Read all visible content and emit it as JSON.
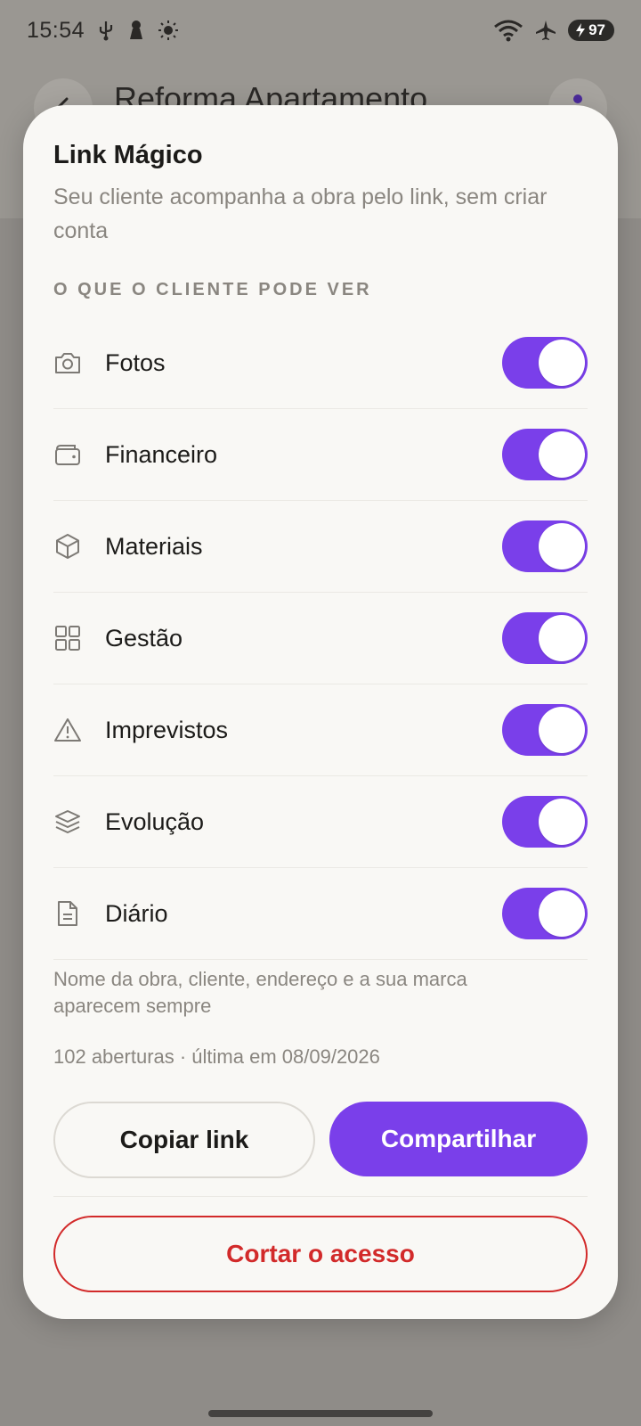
{
  "status_bar": {
    "time": "15:54",
    "battery": "97"
  },
  "background_app": {
    "title": "Reforma Apartamento"
  },
  "sheet": {
    "title": "Link Mágico",
    "subtitle": "Seu cliente acompanha a obra pelo link, sem criar conta",
    "section_label": "O QUE O CLIENTE PODE VER",
    "toggles": [
      {
        "label": "Fotos",
        "icon": "camera-icon",
        "on": true
      },
      {
        "label": "Financeiro",
        "icon": "wallet-icon",
        "on": true
      },
      {
        "label": "Materiais",
        "icon": "box-icon",
        "on": true
      },
      {
        "label": "Gestão",
        "icon": "grid-icon",
        "on": true
      },
      {
        "label": "Imprevistos",
        "icon": "warning-icon",
        "on": true
      },
      {
        "label": "Evolução",
        "icon": "layers-icon",
        "on": true
      },
      {
        "label": "Diário",
        "icon": "document-icon",
        "on": true
      }
    ],
    "note": "Nome da obra, cliente, endereço e a sua marca aparecem sempre",
    "stats": "102 aberturas · última em 08/09/2026",
    "copy_label": "Copiar link",
    "share_label": "Compartilhar",
    "revoke_label": "Cortar o acesso"
  },
  "colors": {
    "accent": "#7a3fea",
    "danger": "#d22a2a",
    "sheet_bg": "#f9f8f5",
    "muted_text": "#8a8680"
  }
}
